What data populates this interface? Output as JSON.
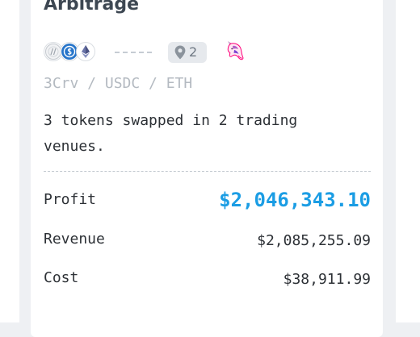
{
  "card": {
    "title": "Arbitrage",
    "tokens": [
      {
        "symbol": "3Crv",
        "icon": "3crv-token-icon"
      },
      {
        "symbol": "USDC",
        "icon": "usdc-token-icon"
      },
      {
        "symbol": "ETH",
        "icon": "eth-token-icon"
      }
    ],
    "venue_count": "2",
    "venue_icon": "uniswap-unicorn-icon",
    "tokens_path": "3Crv / USDC / ETH",
    "description": "3 tokens swapped in 2 trading venues.",
    "metrics": {
      "profit_label": "Profit",
      "profit_value": "$2,046,343.10",
      "revenue_label": "Revenue",
      "revenue_value": "$2,085,255.09",
      "cost_label": "Cost",
      "cost_value": "$38,911.99"
    }
  },
  "colors": {
    "profit": "#1b9de4",
    "title": "#3d4752",
    "muted": "#b4bac1",
    "uniswap": "#ff007a"
  }
}
